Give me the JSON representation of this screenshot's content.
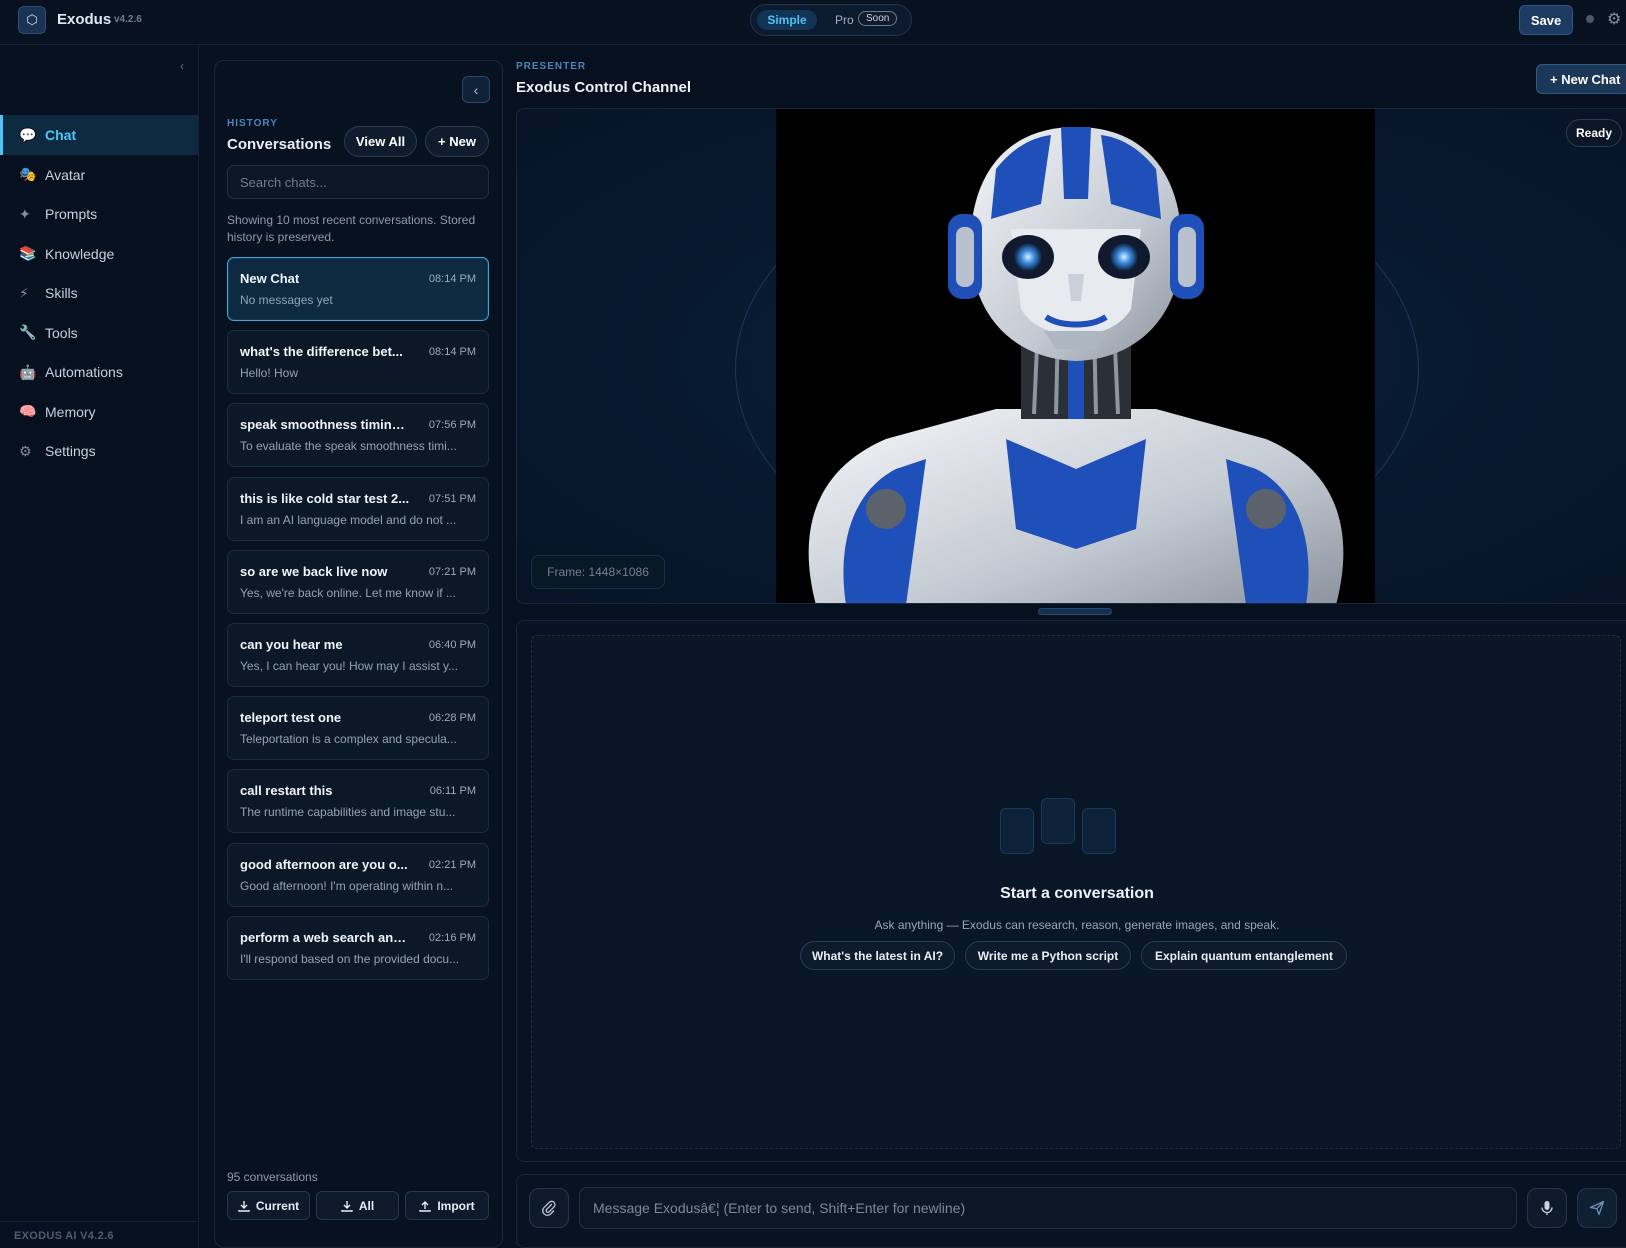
{
  "app": {
    "logo_glyph": "⬡",
    "name": "Exodus",
    "version": "v4.2.6"
  },
  "mode": {
    "simple": "Simple",
    "pro": "Pro",
    "soon": "Soon"
  },
  "header": {
    "save_label": "Save"
  },
  "sidebar": {
    "collapse_glyph": "‹",
    "items": [
      {
        "label": "Chat",
        "icon": "chat-bubble-icon",
        "glyph": "💬",
        "active": true
      },
      {
        "label": "Avatar",
        "icon": "avatar-masks-icon",
        "glyph": "🎭"
      },
      {
        "label": "Prompts",
        "icon": "sparkle-icon",
        "glyph": "✦"
      },
      {
        "label": "Knowledge",
        "icon": "books-icon",
        "glyph": "📚"
      },
      {
        "label": "Skills",
        "icon": "lightning-icon",
        "glyph": "⚡"
      },
      {
        "label": "Tools",
        "icon": "wrench-icon",
        "glyph": "🔧"
      },
      {
        "label": "Automations",
        "icon": "robot-icon",
        "glyph": "🤖"
      },
      {
        "label": "Memory",
        "icon": "brain-icon",
        "glyph": "🧠"
      },
      {
        "label": "Settings",
        "icon": "gear-icon",
        "glyph": "⚙"
      }
    ],
    "footer": "EXODUS AI V4.2.6"
  },
  "history": {
    "label": "HISTORY",
    "title": "Conversations",
    "view_all": "View All",
    "new": "+ New",
    "search_placeholder": "Search chats...",
    "note": "Showing 10 most recent conversations. Stored history is preserved.",
    "conversations": [
      {
        "title": "New Chat",
        "time": "08:14 PM",
        "preview": "No messages yet",
        "active": true
      },
      {
        "title": "what's the difference bet...",
        "time": "08:14 PM",
        "preview": "Hello! How"
      },
      {
        "title": "speak smoothness timing...",
        "time": "07:56 PM",
        "preview": "To evaluate the speak smoothness timi..."
      },
      {
        "title": "this is like cold star test 2...",
        "time": "07:51 PM",
        "preview": "I am an AI language model and do not ..."
      },
      {
        "title": "so are we back live now",
        "time": "07:21 PM",
        "preview": "Yes, we're back online. Let me know if ..."
      },
      {
        "title": "can you hear me",
        "time": "06:40 PM",
        "preview": "Yes, I can hear you! How may I assist y..."
      },
      {
        "title": "teleport test one",
        "time": "06:28 PM",
        "preview": "Teleportation is a complex and specula..."
      },
      {
        "title": "call restart this",
        "time": "06:11 PM",
        "preview": "The runtime capabilities and image stu..."
      },
      {
        "title": "good afternoon are you o...",
        "time": "02:21 PM",
        "preview": "Good afternoon! I'm operating within n..."
      },
      {
        "title": "perform a web search and...",
        "time": "02:16 PM",
        "preview": "I'll respond based on the provided docu..."
      }
    ],
    "count": "95 conversations",
    "export_current": "Current",
    "export_all": "All",
    "import": "Import"
  },
  "presenter": {
    "label": "PRESENTER",
    "title": "Exodus Control Channel",
    "new_chat": "+ New Chat",
    "status": "Ready",
    "frame": "Frame: 1448×1086"
  },
  "chat": {
    "empty_title": "Start a conversation",
    "empty_subtitle": "Ask anything — Exodus can research, reason, generate images, and speak.",
    "suggestions": [
      "What's the latest in AI?",
      "Write me a Python script",
      "Explain quantum entanglement"
    ]
  },
  "composer": {
    "placeholder": "Message Exodusâ€¦ (Enter to send, Shift+Enter for newline)"
  },
  "colors": {
    "accent": "#4fc3f7",
    "background": "#06101f",
    "robot_blue": "#1f4fb8"
  }
}
